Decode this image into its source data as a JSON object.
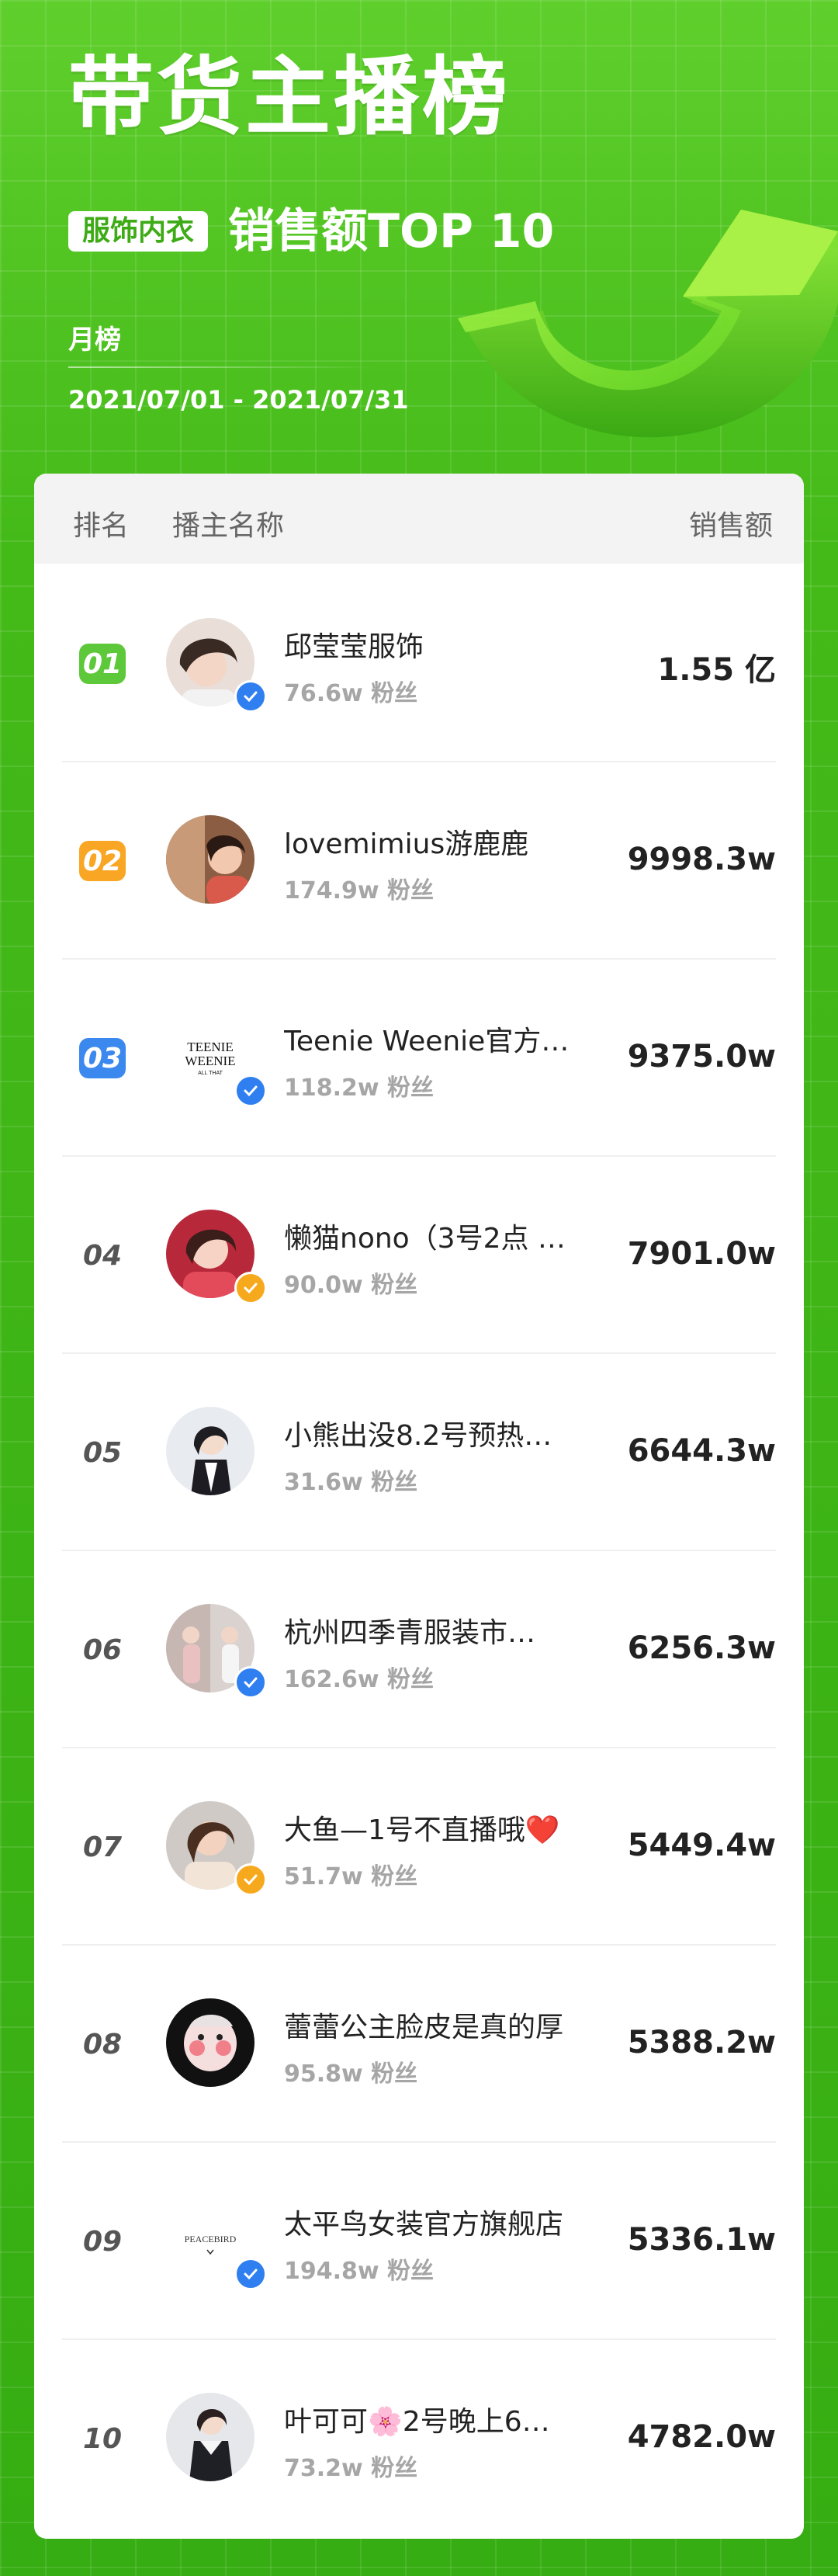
{
  "header": {
    "title": "带货主播榜",
    "category_badge": "服饰内衣",
    "subtitle": "销售额TOP 10",
    "period": "月榜",
    "date_range": "2021/07/01 - 2021/07/31"
  },
  "table": {
    "columns": {
      "rank": "排名",
      "name": "播主名称",
      "sales": "销售额"
    },
    "rows": [
      {
        "rank": "01",
        "name": "邱莹莹服饰",
        "fans": "76.6w 粉丝",
        "sales": "1.55 亿",
        "badge": "blue"
      },
      {
        "rank": "02",
        "name": "lovemimius游鹿鹿",
        "fans": "174.9w 粉丝",
        "sales": "9998.3w",
        "badge": "none"
      },
      {
        "rank": "03",
        "name": "Teenie Weenie官方…",
        "fans": "118.2w 粉丝",
        "sales": "9375.0w",
        "badge": "blue"
      },
      {
        "rank": "04",
        "name": "懒猫nono（3号2点 …",
        "fans": "90.0w 粉丝",
        "sales": "7901.0w",
        "badge": "gold"
      },
      {
        "rank": "05",
        "name": "小熊出没8.2号预热…",
        "fans": "31.6w 粉丝",
        "sales": "6644.3w",
        "badge": "none"
      },
      {
        "rank": "06",
        "name": "杭州四季青服装市…",
        "fans": "162.6w 粉丝",
        "sales": "6256.3w",
        "badge": "blue"
      },
      {
        "rank": "07",
        "name": "大鱼—1号不直播哦❤️",
        "fans": "51.7w 粉丝",
        "sales": "5449.4w",
        "badge": "gold"
      },
      {
        "rank": "08",
        "name": "蕾蕾公主脸皮是真的厚",
        "fans": "95.8w 粉丝",
        "sales": "5388.2w",
        "badge": "none"
      },
      {
        "rank": "09",
        "name": "太平鸟女装官方旗舰店",
        "fans": "194.8w 粉丝",
        "sales": "5336.1w",
        "badge": "blue"
      },
      {
        "rank": "10",
        "name": "叶可可🌸2号晚上6…",
        "fans": "73.2w 粉丝",
        "sales": "4782.0w",
        "badge": "none"
      }
    ]
  },
  "logos": {
    "teenie": [
      "TEENIE",
      "WEENIE",
      "ALL THAT"
    ],
    "peacebird": "PEACEBIRD"
  },
  "colors": {
    "brand_green": "#3fb61a",
    "rank1": "#5ec83b",
    "rank2": "#f8a623",
    "rank3": "#3b88ee",
    "verify_blue": "#2f7ff0",
    "verify_gold": "#f7a91d"
  }
}
